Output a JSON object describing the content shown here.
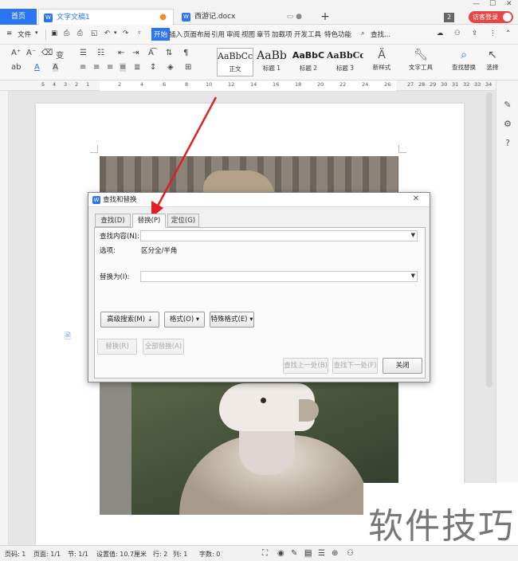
{
  "tabs": {
    "home": "首页",
    "active_doc": "文字文稿1",
    "other_doc": "西游记.docx",
    "new_tab": "+",
    "window_badge": "2",
    "login": "访客登录"
  },
  "menu": {
    "file": "文件",
    "items": [
      "开始",
      "插入",
      "页面布局",
      "引用",
      "审阅",
      "视图",
      "章节",
      "加载项",
      "开发工具",
      "特色功能"
    ],
    "search": "查找..."
  },
  "ribbon": {
    "styles": [
      {
        "sample": "AaBbCcDd",
        "name": "正文"
      },
      {
        "sample": "AaBb",
        "name": "标题 1"
      },
      {
        "sample": "AaBbC",
        "name": "标题 2"
      },
      {
        "sample": "AaBbCc",
        "name": "标题 3"
      }
    ],
    "new_style": "新样式",
    "text_tools": "文字工具",
    "find_replace": "查找替换",
    "select": "选择"
  },
  "ruler": {
    "numbers": [
      "5",
      "4",
      "3",
      "2",
      "1",
      "",
      "2",
      "4",
      "6",
      "8",
      "10",
      "12",
      "14",
      "16",
      "18",
      "20",
      "22",
      "24",
      "26",
      "27",
      "28",
      "29",
      "30",
      "31",
      "32",
      "33",
      "34"
    ]
  },
  "dialog": {
    "title": "查找和替换",
    "close": "✕",
    "tabs": [
      "查找(D)",
      "替换(P)",
      "定位(G)"
    ],
    "find_label": "查找内容(N):",
    "find_value": "",
    "options_label": "选项:",
    "options_value": "区分全/半角",
    "replace_label": "替换为(I):",
    "replace_value": "",
    "advanced_search": "高级搜索(M)",
    "format": "格式(O)",
    "special_format": "特殊格式(E)",
    "replace": "替换(R)",
    "replace_all": "全部替换(A)",
    "find_prev": "查找上一处(B)",
    "find_next": "查找下一处(F)",
    "close_btn": "关闭"
  },
  "status": {
    "page_no": "页码: 1",
    "pages": "页面: 1/1",
    "section": "节: 1/1",
    "setting": "设置值: 10.7厘米",
    "row": "行: 2",
    "col": "列: 1",
    "words": "字数: 0"
  },
  "watermark": "软件技巧",
  "colors": {
    "accent": "#2a75f3",
    "login_red": "#e64646",
    "arrow_red": "#e02020"
  }
}
